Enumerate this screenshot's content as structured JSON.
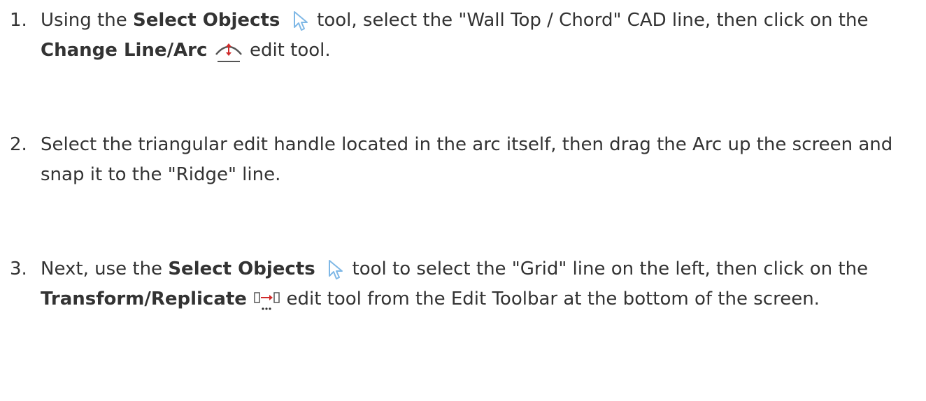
{
  "steps": [
    {
      "number": "1.",
      "text_a": "Using the ",
      "bold_a": "Select Objects",
      "icon_a": "select-objects-arrow-icon",
      "text_b": " tool, select the \"Wall Top / Chord\" CAD line, then click on the ",
      "bold_b": "Change Line/Arc",
      "icon_b": "change-line-arc-icon",
      "text_c": " edit tool."
    },
    {
      "number": "2.",
      "text": "Select the triangular edit handle located in the arc itself, then drag the Arc up the screen and snap it to the \"Ridge\" line."
    },
    {
      "number": "3.",
      "text_a": "Next, use the ",
      "bold_a": "Select Objects",
      "icon_a": "select-objects-arrow-icon",
      "text_b": " tool to select the \"Grid\" line on the left, then click on the ",
      "bold_b": "Transform/Replicate",
      "icon_b": "transform-replicate-icon",
      "text_c": " edit tool from the Edit Toolbar at the bottom of the screen."
    }
  ],
  "colors": {
    "text": "#333333",
    "arrow_icon": "#7fb8e6",
    "arc_icon_red": "#d02a2a"
  }
}
